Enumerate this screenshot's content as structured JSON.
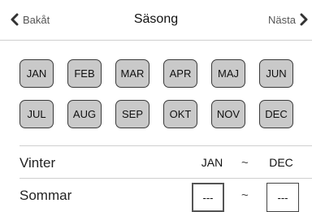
{
  "header": {
    "back_label": "Bakåt",
    "title": "Säsong",
    "next_label": "Nästa"
  },
  "months": [
    "JAN",
    "FEB",
    "MAR",
    "APR",
    "MAJ",
    "JUN",
    "JUL",
    "AUG",
    "SEP",
    "OKT",
    "NOV",
    "DEC"
  ],
  "seasons": [
    {
      "name": "Vinter",
      "start": "JAN",
      "separator": "~",
      "end": "DEC"
    },
    {
      "name": "Sommar",
      "start": "---",
      "separator": "~",
      "end": "---"
    }
  ],
  "colors": {
    "month_button_bg": "#c9c9c9",
    "month_button_border": "#3a3a3a",
    "divider": "#cfcfcf"
  }
}
